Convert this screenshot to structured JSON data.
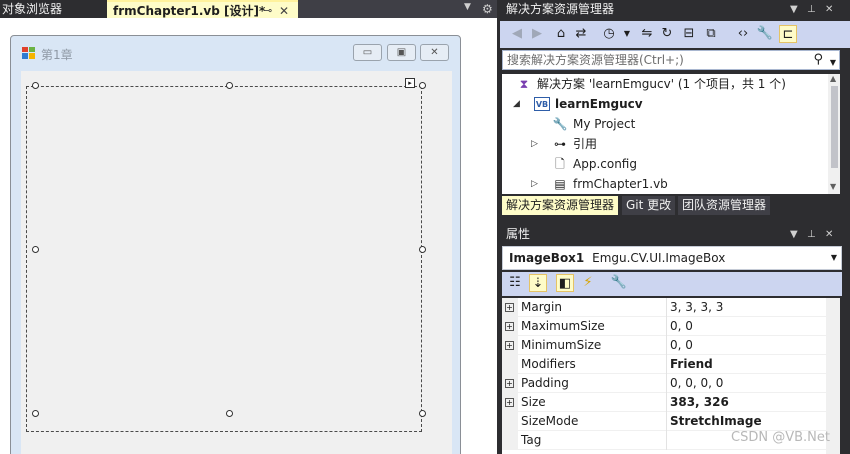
{
  "tabs": {
    "object_browser": "对象浏览器",
    "active_tab": "frmChapter1.vb [设计]*",
    "pin_icon": "pin-icon",
    "close_icon": "close-icon"
  },
  "designer": {
    "form_title": "第1章",
    "smart_tag_glyph": "▸"
  },
  "solution_explorer": {
    "title": "解决方案资源管理器",
    "search_placeholder": "搜索解决方案资源管理器(Ctrl+;)",
    "tree": [
      {
        "label": "解决方案 'learnEmgucv' (1 个项目，共 1 个)",
        "icon": "solution-icon"
      },
      {
        "label": "learnEmgucv",
        "icon": "vb-project-icon",
        "bold": true,
        "expanded": true
      },
      {
        "label": "My Project",
        "icon": "wrench-icon"
      },
      {
        "label": "引用",
        "icon": "references-icon",
        "collapsed": true
      },
      {
        "label": "App.config",
        "icon": "config-file-icon"
      },
      {
        "label": "frmChapter1.vb",
        "icon": "form-file-icon",
        "collapsed": true
      }
    ],
    "bottom_tabs": [
      "解决方案资源管理器",
      "Git 更改",
      "团队资源管理器"
    ]
  },
  "properties": {
    "title": "属性",
    "object_name": "ImageBox1",
    "object_type": "Emgu.CV.UI.ImageBox",
    "rows": [
      {
        "name": "Margin",
        "value": "3, 3, 3, 3",
        "expandable": true,
        "bold": false
      },
      {
        "name": "MaximumSize",
        "value": "0, 0",
        "expandable": true,
        "bold": false
      },
      {
        "name": "MinimumSize",
        "value": "0, 0",
        "expandable": true,
        "bold": false
      },
      {
        "name": "Modifiers",
        "value": "Friend",
        "expandable": false,
        "bold": true
      },
      {
        "name": "Padding",
        "value": "0, 0, 0, 0",
        "expandable": true,
        "bold": false
      },
      {
        "name": "Size",
        "value": "383, 326",
        "expandable": true,
        "bold": true
      },
      {
        "name": "SizeMode",
        "value": "StretchImage",
        "expandable": false,
        "bold": true
      },
      {
        "name": "Tag",
        "value": "",
        "expandable": false,
        "bold": false
      }
    ]
  },
  "watermark": "CSDN @VB.Net",
  "colors": {
    "dark_chrome": "#2d2d30",
    "active_tab": "#fefcc8",
    "toolbar": "#ccd5f0",
    "form_border": "#d9e6f5"
  }
}
